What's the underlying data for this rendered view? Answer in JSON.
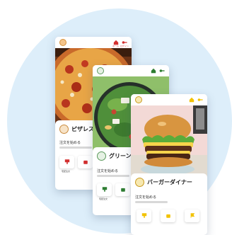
{
  "colors": {
    "background_blob": "#ddeefa",
    "pizza_accent": "#d32f2f",
    "salad_accent": "#2e7d32",
    "burger_accent": "#f2c200"
  },
  "cards": [
    {
      "brand_name": "ピザレスト",
      "order_label": "注文を始める",
      "top_icons": [
        "home-icon",
        "key-icon"
      ],
      "top_labels": [
        "ホーム",
        "ログイン"
      ],
      "tile_labels": [
        "宅配注文",
        ""
      ]
    },
    {
      "brand_name": "グリーンサ",
      "order_label": "注文を始める",
      "top_icons": [
        "home-icon",
        "key-icon"
      ],
      "tile_labels": [
        "宅配注文",
        ""
      ]
    },
    {
      "brand_name": "バーガーダイナー",
      "order_label": "注文を始める",
      "top_icons": [
        "home-icon",
        "key-icon"
      ],
      "tile_labels": [
        "",
        "",
        ""
      ]
    }
  ]
}
